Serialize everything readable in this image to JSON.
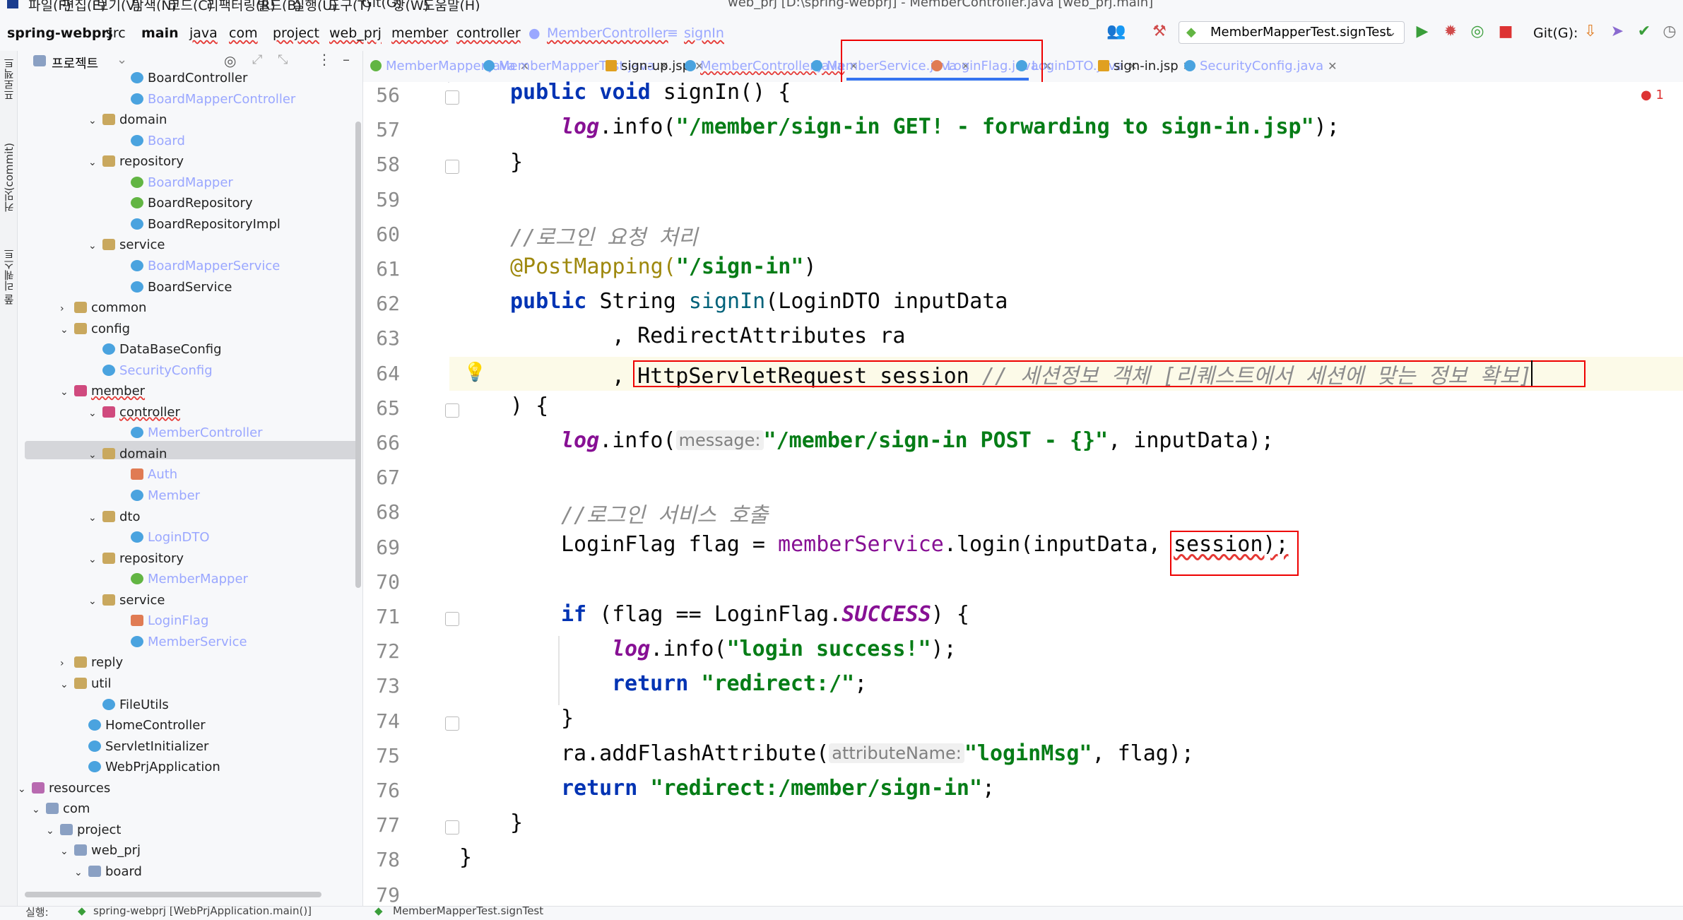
{
  "menu": [
    "파일(F)",
    "편집(E)",
    "보기(V)",
    "탐색(N)",
    "코드(C)",
    "리팩터링(R)",
    "빌드(B)",
    "실행(U)",
    "도구(T)",
    "Git(G)",
    "창(W)",
    "도움말(H)"
  ],
  "window_title": "web_prj [D:\\spring-webprj] - MemberController.java [web_prj.main]",
  "breadcrumb": [
    "spring-webprj",
    "src",
    "main",
    "java",
    "com",
    "project",
    "web_prj",
    "member",
    "controller",
    "MemberController",
    "signIn"
  ],
  "run_config": "MemberMapperTest.signTest",
  "git_label": "Git(G):",
  "project_panel": {
    "title": "프로젝트"
  },
  "left_stripe": [
    "프로젝트",
    "커밋(commit)",
    "풀 리퀘스트"
  ],
  "tree": [
    {
      "label": "BoardController",
      "icon": "class-icon",
      "muted": false
    },
    {
      "label": "BoardMapperController",
      "icon": "class-icon",
      "muted": true
    },
    {
      "label": "domain",
      "icon": "package-icon",
      "muted": false
    },
    {
      "label": "Board",
      "icon": "class-icon",
      "muted": true
    },
    {
      "label": "repository",
      "icon": "package-icon",
      "muted": false
    },
    {
      "label": "BoardMapper",
      "icon": "interface-icon",
      "muted": true
    },
    {
      "label": "BoardRepository",
      "icon": "interface-icon",
      "muted": false
    },
    {
      "label": "BoardRepositoryImpl",
      "icon": "class-icon",
      "muted": false
    },
    {
      "label": "service",
      "icon": "package-icon",
      "muted": false
    },
    {
      "label": "BoardMapperService",
      "icon": "class-icon",
      "muted": true
    },
    {
      "label": "BoardService",
      "icon": "class-icon",
      "muted": false
    },
    {
      "label": "common",
      "icon": "package-icon",
      "muted": false
    },
    {
      "label": "config",
      "icon": "package-icon",
      "muted": false
    },
    {
      "label": "DataBaseConfig",
      "icon": "class-icon",
      "muted": false
    },
    {
      "label": "SecurityConfig",
      "icon": "class-icon",
      "muted": true
    },
    {
      "label": "member",
      "icon": "member-package-icon",
      "muted": false
    },
    {
      "label": "controller",
      "icon": "member-package-icon",
      "muted": false
    },
    {
      "label": "MemberController",
      "icon": "class-icon",
      "muted": true
    },
    {
      "label": "domain",
      "icon": "package-icon",
      "muted": false
    },
    {
      "label": "Auth",
      "icon": "enum-icon",
      "muted": true
    },
    {
      "label": "Member",
      "icon": "class-icon",
      "muted": true
    },
    {
      "label": "dto",
      "icon": "package-icon",
      "muted": false
    },
    {
      "label": "LoginDTO",
      "icon": "class-icon",
      "muted": true
    },
    {
      "label": "repository",
      "icon": "package-icon",
      "muted": false
    },
    {
      "label": "MemberMapper",
      "icon": "interface-icon",
      "muted": true
    },
    {
      "label": "service",
      "icon": "package-icon",
      "muted": false
    },
    {
      "label": "LoginFlag",
      "icon": "enum-icon",
      "muted": true
    },
    {
      "label": "MemberService",
      "icon": "class-icon",
      "muted": true
    },
    {
      "label": "reply",
      "icon": "package-icon",
      "muted": false
    },
    {
      "label": "util",
      "icon": "package-icon",
      "muted": false
    },
    {
      "label": "FileUtils",
      "icon": "class-icon",
      "muted": false
    },
    {
      "label": "HomeController",
      "icon": "class-icon",
      "muted": false
    },
    {
      "label": "ServletInitializer",
      "icon": "class-icon",
      "muted": false
    },
    {
      "label": "WebPrjApplication",
      "icon": "class-icon",
      "muted": false
    },
    {
      "label": "resources",
      "icon": "resources-folder-icon",
      "muted": false
    },
    {
      "label": "com",
      "icon": "folder-icon",
      "muted": false
    },
    {
      "label": "project",
      "icon": "folder-icon",
      "muted": false
    },
    {
      "label": "web_prj",
      "icon": "folder-icon",
      "muted": false
    },
    {
      "label": "board",
      "icon": "folder-icon",
      "muted": false
    }
  ],
  "tabs": [
    {
      "label": "MemberMapper.java",
      "icon": "interface-icon",
      "muted": true
    },
    {
      "label": "MemberMapperTest.java",
      "icon": "class-icon",
      "muted": true
    },
    {
      "label": "sign-up.jsp",
      "icon": "jsp-icon",
      "muted": false
    },
    {
      "label": "MemberController.java",
      "icon": "class-icon",
      "muted": true,
      "active": true
    },
    {
      "label": "MemberService.java",
      "icon": "class-icon",
      "muted": true
    },
    {
      "label": "LoginFlag.java",
      "icon": "enum-icon",
      "muted": true
    },
    {
      "label": "LoginDTO.java",
      "icon": "class-icon",
      "muted": true
    },
    {
      "label": "sign-in.jsp",
      "icon": "jsp-icon",
      "muted": false
    },
    {
      "label": "SecurityConfig.java",
      "icon": "class-icon",
      "muted": true
    }
  ],
  "error_count": "1",
  "line_numbers": [
    "56",
    "57",
    "58",
    "59",
    "60",
    "61",
    "62",
    "63",
    "64",
    "65",
    "66",
    "67",
    "68",
    "69",
    "70",
    "71",
    "72",
    "73",
    "74",
    "75",
    "76",
    "77",
    "78",
    "79"
  ],
  "code": {
    "l56_kw": "public void ",
    "l56_rest": "signIn() {",
    "l57_log": "log",
    "l57_a": ".info(",
    "l57_str": "\"/member/sign-in GET! - forwarding to sign-in.jsp\"",
    "l57_b": ");",
    "l58": "}",
    "l60": "//로그인 요청 처리",
    "l61_ann": "@PostMapping(",
    "l61_str": "\"/sign-in\"",
    "l61_b": ")",
    "l62_kw": "public ",
    "l62_type": "String ",
    "l62_m": "signIn",
    "l62_rest": "(LoginDTO inputData",
    "l63": ", RedirectAttributes ra",
    "l64_a": ", ",
    "l64_b": "HttpServletRequest session ",
    "l64_c": "// 세션정보 객체 [리퀘스트에서 세션에 맞는 정보 확보]",
    "l65": ") {",
    "l66_log": "log",
    "l66_a": ".info(",
    "l66_hint": "message:",
    "l66_str": "\"/member/sign-in POST - {}\"",
    "l66_b": ", inputData);",
    "l68": "//로그인 서비스 호출",
    "l69_a": "LoginFlag flag = ",
    "l69_fld": "memberService",
    "l69_b": ".login(inputData, ",
    "l69_c": "session);",
    "l71_kw": "if ",
    "l71_a": "(flag == LoginFlag.",
    "l71_enum": "SUCCESS",
    "l71_b": ") {",
    "l72_log": "log",
    "l72_a": ".info(",
    "l72_str": "\"login success!\"",
    "l72_b": ");",
    "l73_kw": "return ",
    "l73_str": "\"redirect:/\"",
    "l73_b": ";",
    "l74": "}",
    "l75_a": "ra.addFlashAttribute(",
    "l75_hint": "attributeName:",
    "l75_str": "\"loginMsg\"",
    "l75_b": ", flag);",
    "l76_kw": "return ",
    "l76_str": "\"redirect:/member/sign-in\"",
    "l76_b": ";",
    "l77": "}",
    "l78": "}"
  },
  "statusbar": {
    "run_label": "실행:",
    "run_item1": "spring-webprj [WebPrjApplication.main()]",
    "run_item2": "MemberMapperTest.signTest"
  }
}
